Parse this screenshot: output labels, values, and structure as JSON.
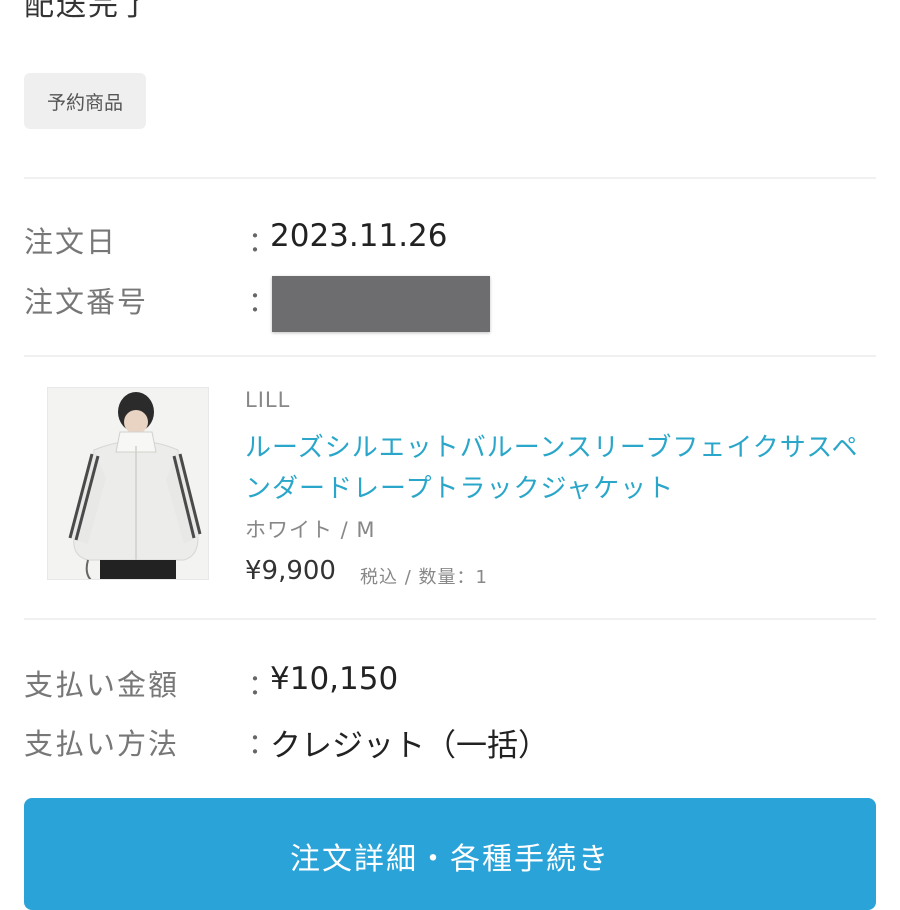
{
  "header": {
    "cut_off_title": "配送完了"
  },
  "badge": "予約商品",
  "order": {
    "date_label": "注文日",
    "date_value": "2023.11.26",
    "number_label": "注文番号",
    "colon": "："
  },
  "product": {
    "brand": "LILL",
    "name": "ルーズシルエットバルーンスリーブフェイクサスペンダードレープトラックジャケット",
    "variant": "ホワイト / M",
    "price": "¥9,900",
    "price_note": "税込 / 数量：1",
    "image_alt": "product-photo-white-track-jacket"
  },
  "payment": {
    "amount_label": "支払い金額",
    "amount_value": "¥10,150",
    "method_label": "支払い方法",
    "method_value": "クレジット（一括）"
  },
  "cta": {
    "label": "注文詳細・各種手続き"
  },
  "colors": {
    "accent": "#2aa3d8",
    "link": "#29a6c9"
  }
}
